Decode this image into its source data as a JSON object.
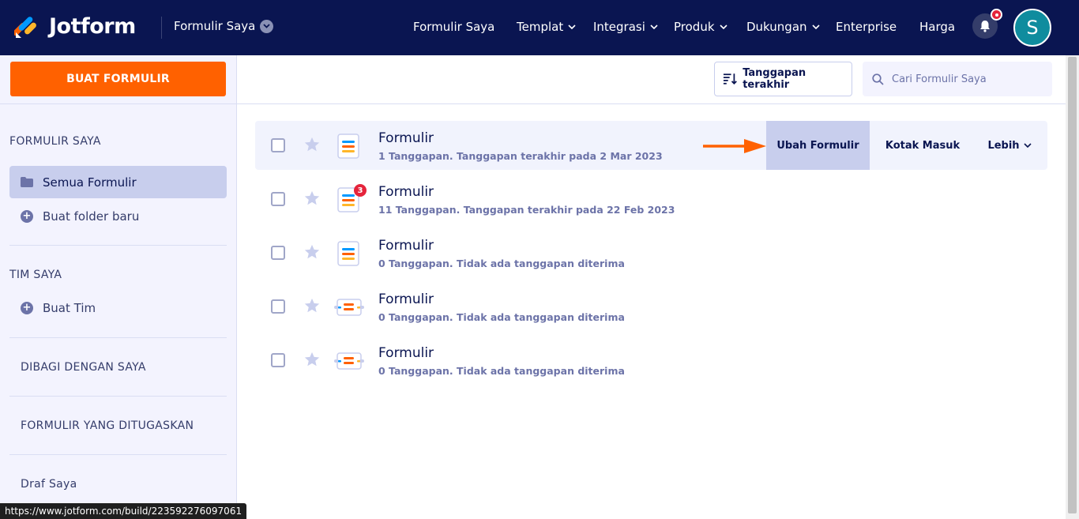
{
  "header": {
    "brand": "Jotform",
    "breadcrumb": "Formulir Saya",
    "nav": [
      {
        "label": "Formulir Saya",
        "dropdown": false
      },
      {
        "label": "Templat",
        "dropdown": true
      },
      {
        "label": "Integrasi",
        "dropdown": true
      },
      {
        "label": "Produk",
        "dropdown": true
      },
      {
        "label": "Dukungan",
        "dropdown": true
      },
      {
        "label": "Enterprise",
        "dropdown": false
      },
      {
        "label": "Harga",
        "dropdown": false
      }
    ],
    "avatar_initial": "S"
  },
  "sidebar": {
    "create_button": "BUAT FORMULIR",
    "section_my_forms": "FORMULIR SAYA",
    "all_forms": "Semua Formulir",
    "new_folder": "Buat folder baru",
    "section_my_team": "TIM SAYA",
    "create_team": "Buat Tim",
    "shared_with_me": "DIBAGI DENGAN SAYA",
    "assigned_forms": "FORMULIR YANG DITUGASKAN",
    "drafts": "Draf Saya"
  },
  "toolbar": {
    "sort_label": "Tanggapan terakhir",
    "search_placeholder": "Cari Formulir Saya"
  },
  "forms": [
    {
      "title": "Formulir",
      "subtitle": "1 Tanggapan. Tanggapan terakhir pada 2 Mar 2023",
      "icon": "form-list-icon",
      "badge": ""
    },
    {
      "title": "Formulir",
      "subtitle": "11 Tanggapan. Tanggapan terakhir pada 22 Feb 2023",
      "icon": "form-list-icon",
      "badge": "3"
    },
    {
      "title": "Formulir",
      "subtitle": "0 Tanggapan. Tidak ada tanggapan diterima",
      "icon": "form-list-icon",
      "badge": ""
    },
    {
      "title": "Formulir",
      "subtitle": "0 Tanggapan. Tidak ada tanggapan diterima",
      "icon": "form-card-icon",
      "badge": ""
    },
    {
      "title": "Formulir",
      "subtitle": "0 Tanggapan. Tidak ada tanggapan diterima",
      "icon": "form-card-icon",
      "badge": ""
    }
  ],
  "row_actions": {
    "edit": "Ubah Formulir",
    "inbox": "Kotak Masuk",
    "more": "Lebih"
  },
  "status_url": "https://www.jotform.com/build/223592276097061",
  "colors": {
    "navy": "#0a1551",
    "orange": "#ff6100",
    "sidebar_bg": "#f3f3fe",
    "active_bg": "#c8ceed",
    "badge_red": "#e5243b"
  }
}
